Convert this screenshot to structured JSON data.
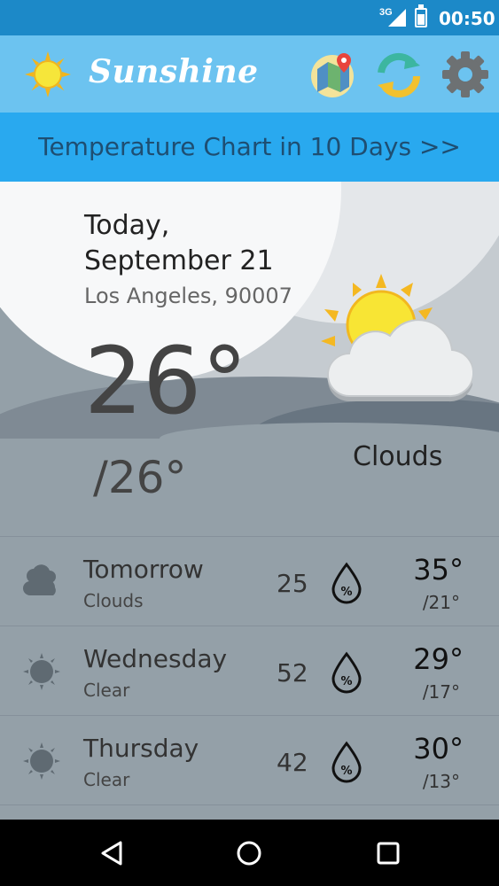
{
  "status_bar": {
    "network": "3G",
    "time": "00:50"
  },
  "app_bar": {
    "title": "Sunshine",
    "logo_icon": "sun-icon",
    "actions": [
      {
        "name": "map",
        "icon": "map-pin-icon"
      },
      {
        "name": "refresh",
        "icon": "refresh-icon"
      },
      {
        "name": "settings",
        "icon": "gear-icon"
      }
    ]
  },
  "chart_link": {
    "label": "Temperature Chart in 10 Days >>"
  },
  "today": {
    "date": "Today, September 21",
    "location": "Los Angeles, 90007",
    "temp_current": "26°",
    "temp_low": "/26°",
    "condition": "Clouds",
    "icon": "partly-cloudy-icon"
  },
  "forecast": [
    {
      "day": "Tomorrow",
      "description": "Clouds",
      "humidity": "25",
      "high": "35°",
      "low": "/21°",
      "icon": "clouds-icon"
    },
    {
      "day": "Wednesday",
      "description": "Clear",
      "humidity": "52",
      "high": "29°",
      "low": "/17°",
      "icon": "clear-icon"
    },
    {
      "day": "Thursday",
      "description": "Clear",
      "humidity": "42",
      "high": "30°",
      "low": "/13°",
      "icon": "clear-icon"
    }
  ],
  "colors": {
    "status_bar": "#1c89c8",
    "app_bar": "#6cc3f0",
    "chart_link_bg": "#29a9ef",
    "chart_link_text": "#1e4e72",
    "list_bg": "#94a0a8"
  },
  "nav_bar": {
    "buttons": [
      "back-icon",
      "home-icon",
      "recents-icon"
    ]
  }
}
